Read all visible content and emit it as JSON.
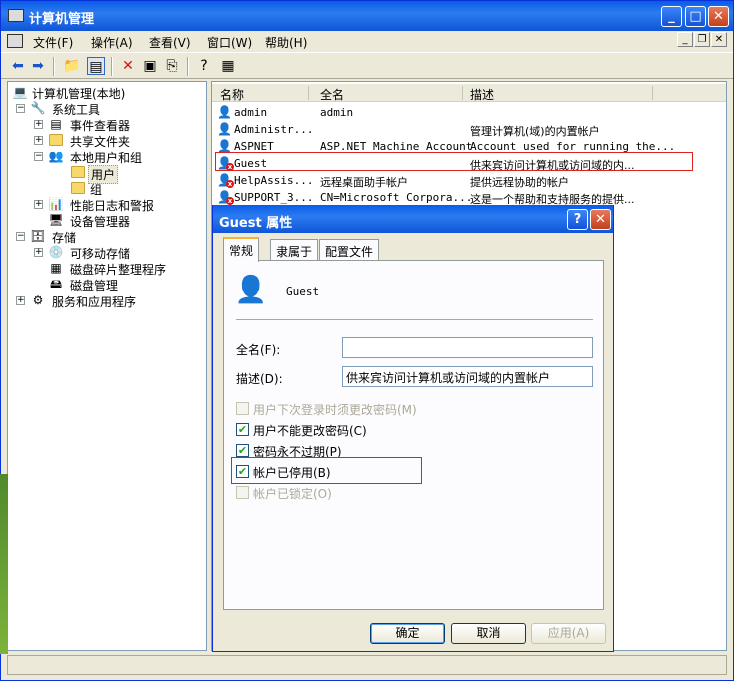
{
  "window": {
    "title": "计算机管理"
  },
  "menu": [
    "文件(F)",
    "操作(A)",
    "查看(V)",
    "窗口(W)",
    "帮助(H)"
  ],
  "tree": {
    "root": "计算机管理(本地)",
    "system_tools": "系统工具",
    "event_viewer": "事件查看器",
    "shared_folders": "共享文件夹",
    "local_users": "本地用户和组",
    "users": "用户",
    "groups": "组",
    "perf_logs": "性能日志和警报",
    "device_manager": "设备管理器",
    "storage": "存储",
    "removable": "可移动存储",
    "defrag": "磁盘碎片整理程序",
    "disk_mgmt": "磁盘管理",
    "services": "服务和应用程序"
  },
  "list": {
    "headers": [
      "名称",
      "全名",
      "描述"
    ],
    "rows": [
      {
        "name": "admin",
        "full": "admin",
        "desc": ""
      },
      {
        "name": "Administr...",
        "full": "",
        "desc": "管理计算机(域)的内置帐户"
      },
      {
        "name": "ASPNET",
        "full": "ASP.NET Machine Account",
        "desc": "Account used for running the..."
      },
      {
        "name": "Guest",
        "full": "",
        "desc": "供来宾访问计算机或访问域的内..."
      },
      {
        "name": "HelpAssis...",
        "full": "远程桌面助手帐户",
        "desc": "提供远程协助的帐户"
      },
      {
        "name": "SUPPORT_3...",
        "full": "CN=Microsoft Corpora...",
        "desc": "这是一个帮助和支持服务的提供..."
      }
    ]
  },
  "dialog": {
    "title": "Guest 属性",
    "tabs": [
      "常规",
      "隶属于",
      "配置文件"
    ],
    "username": "Guest",
    "fullname_label": "全名(F):",
    "fullname_value": "",
    "desc_label": "描述(D):",
    "desc_value": "供来宾访问计算机或访问域的内置帐户",
    "checks": [
      {
        "label": "用户下次登录时须更改密码(M)",
        "checked": false,
        "disabled": true
      },
      {
        "label": "用户不能更改密码(C)",
        "checked": true,
        "disabled": false
      },
      {
        "label": "密码永不过期(P)",
        "checked": true,
        "disabled": false
      },
      {
        "label": "帐户已停用(B)",
        "checked": true,
        "disabled": false
      },
      {
        "label": "帐户已锁定(O)",
        "checked": false,
        "disabled": true
      }
    ],
    "ok": "确定",
    "cancel": "取消",
    "apply": "应用(A)"
  },
  "colors": {
    "titlebar": "#0a5ce8",
    "highlight_box": "#d22222",
    "check_green": "#21a121"
  }
}
